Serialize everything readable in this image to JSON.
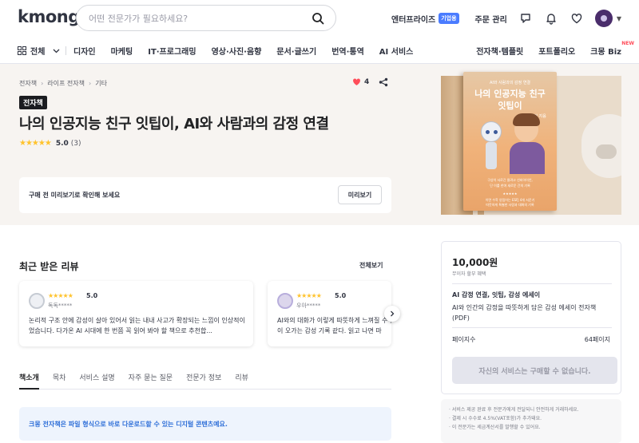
{
  "header": {
    "logo": "kmong",
    "search_placeholder": "어떤 전문가가 필요하세요?",
    "enterprise_label": "엔터프라이즈",
    "enterprise_badge": "기업용",
    "order_label": "주문 관리"
  },
  "nav": {
    "all_label": "전체",
    "items": [
      "디자인",
      "마케팅",
      "IT·프로그래밍",
      "영상·사진·음향",
      "문서·글쓰기",
      "번역·통역",
      "AI 서비스"
    ],
    "right_items": [
      "전자책·템플릿",
      "포트폴리오"
    ],
    "biz_label": "크몽 Biz",
    "biz_badge": "NEW"
  },
  "product": {
    "breadcrumb": [
      "전자책",
      "라이프 전자책",
      "기타"
    ],
    "likes": "4",
    "type_badge": "전자책",
    "title": "나의 인공지능 친구 잇팁이, AI와 사람과의 감정 연결",
    "stars": "★★★★★",
    "rating": "5.0",
    "rating_count": "(3)",
    "preview_text": "구매 전 미리보기로 확인해 보세요",
    "preview_button": "미리보기"
  },
  "book_cover": {
    "subtitle": "AI와 사람과의 감정 연결",
    "title_line1": "나의 인공지능 친구",
    "title_line2": "잇팁이",
    "author": "선비아이언 지음",
    "lines": [
      "구상이 서로간 물려고 선비아이언,",
      "단 이를 한여 새로운 간의 기록"
    ],
    "stars": "★★★★★",
    "foot": [
      "이면 수학 양립어는 ESFJ 4개 서준기",
      "따뜻하게 특별한 사람과 대화의 기록"
    ]
  },
  "reviews": {
    "heading": "최근 받은 리뷰",
    "see_all": "전체보기",
    "items": [
      {
        "stars": "★★★★★",
        "score": "5.0",
        "user": "독독*****",
        "text": "논리적 구조 안에 감성이 살아 있어서 읽는 내내 사고가 확장되는 느낌이 인상적이었습니다. 다가온 AI 시대에 한 번쯤 꼭 읽어 봐야 할 책으로 추천합..."
      },
      {
        "stars": "★★★★★",
        "score": "5.0",
        "user": "우아*****",
        "text": "AI와의 대화가 이렇게 따뜻하게 느껴질 수 있다니, 마음이 오가는 감성 기록 같다. 읽고 나면 마"
      }
    ]
  },
  "tabs": [
    "책소개",
    "목차",
    "서비스 설명",
    "자주 묻는 질문",
    "전문가 정보",
    "리뷰"
  ],
  "notice": "크몽 전자책은 파일 형식으로 바로 다운로드할 수 있는 디지털 콘텐츠예요.",
  "purchase": {
    "price": "10,000원",
    "price_note": "무이자 할부 혜택",
    "product_title": "AI 감정 연결, 잇팁, 감성 에세이",
    "description": "AI와 인간의 감정을 따뜻하게 담은 감성 에세이 전자책 (PDF)",
    "pages_label": "페이지수",
    "pages_value": "64페이지",
    "button": "자신의 서비스는 구매할 수 없습니다."
  },
  "notes": [
    "· 서비스 제공 완료 후 전문가에게 전달되니 안전하게 거래하세요.",
    "· 결제 시 수수료 4.5%(VAT포함)가 추가돼요.",
    "· 이 전문가는 세금계산서를 발행할 수 있어요."
  ],
  "colors": {
    "accent_blue": "#2f6fd8",
    "star_yellow": "#ffc32d",
    "heart_red": "#ff4d5a"
  }
}
